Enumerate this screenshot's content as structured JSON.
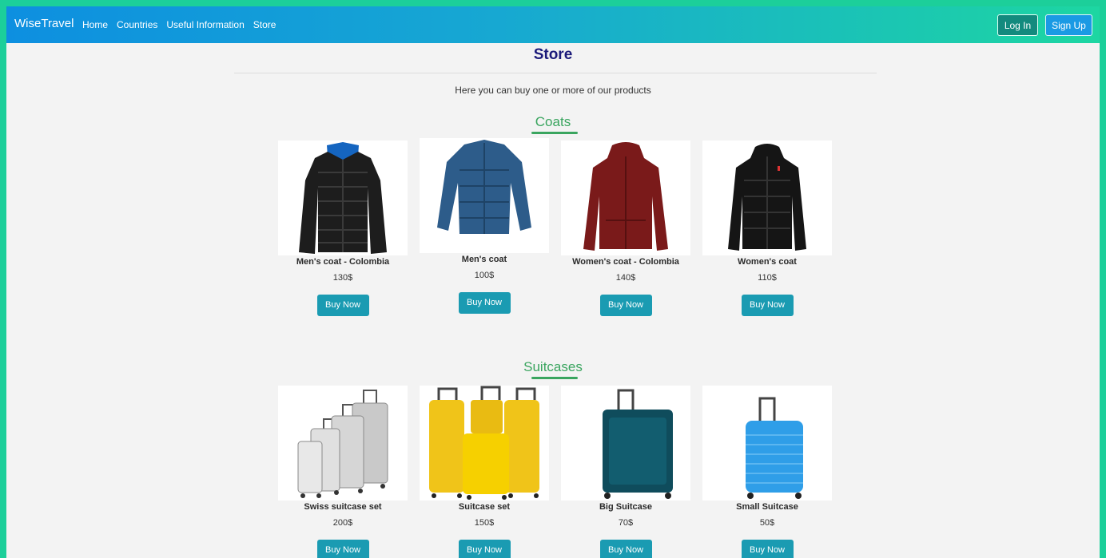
{
  "navbar": {
    "brand": "WiseTravel",
    "links": [
      "Home",
      "Countries",
      "Useful Information",
      "Store"
    ],
    "login_label": "Log In",
    "signup_label": "Sign Up"
  },
  "page": {
    "title": "Store",
    "intro": "Here you can buy one or more of our products"
  },
  "sections": [
    {
      "heading": "Coats",
      "buy_label": "Buy Now",
      "products": [
        {
          "name": "Men's coat - Colombia",
          "price": "130$",
          "image": "black-puffer-jacket"
        },
        {
          "name": "Men's coat",
          "price": "100$",
          "image": "blue-puffer-jacket"
        },
        {
          "name": "Women's coat - Colombia",
          "price": "140$",
          "image": "red-hooded-jacket"
        },
        {
          "name": "Women's coat",
          "price": "110$",
          "image": "black-hooded-jacket"
        }
      ]
    },
    {
      "heading": "Suitcases",
      "buy_label": "Buy Now",
      "products": [
        {
          "name": "Swiss suitcase set",
          "price": "200$",
          "image": "silver-suitcase-set"
        },
        {
          "name": "Suitcase set",
          "price": "150$",
          "image": "yellow-suitcase-set"
        },
        {
          "name": "Big Suitcase",
          "price": "70$",
          "image": "teal-soft-suitcase"
        },
        {
          "name": "Small Suitcase",
          "price": "50$",
          "image": "blue-hard-suitcase"
        }
      ]
    }
  ],
  "colors": {
    "accent_green": "#3aa55f",
    "title_navy": "#1b1a7a",
    "buy_button": "#1a9bb2"
  }
}
